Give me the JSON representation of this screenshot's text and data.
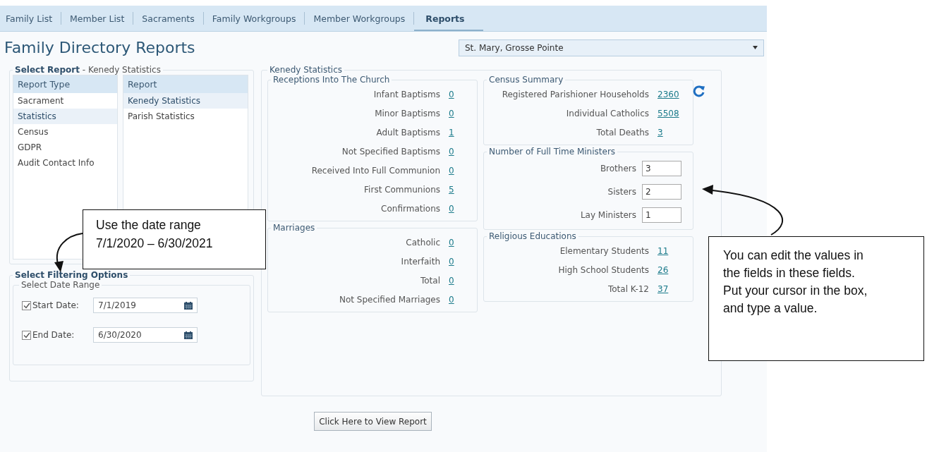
{
  "tabs": [
    {
      "label": "Family List",
      "selected": false
    },
    {
      "label": "Member List",
      "selected": false
    },
    {
      "label": "Sacraments",
      "selected": false
    },
    {
      "label": "Family Workgroups",
      "selected": false
    },
    {
      "label": "Member Workgroups",
      "selected": false
    },
    {
      "label": "Reports",
      "selected": true
    }
  ],
  "page_title": "Family Directory Reports",
  "parish_select": {
    "value": "St. Mary, Grosse Pointe"
  },
  "select_report": {
    "legend": "Select Report",
    "subtitle": "- Kenedy Statistics",
    "columns": [
      {
        "header": "Report Type",
        "items": [
          {
            "label": "Sacrament",
            "selected": false
          },
          {
            "label": "Statistics",
            "selected": true
          },
          {
            "label": "Census",
            "selected": false
          },
          {
            "label": "GDPR",
            "selected": false
          },
          {
            "label": "Audit Contact Info",
            "selected": false
          }
        ]
      },
      {
        "header": "Report",
        "items": [
          {
            "label": "Kenedy Statistics",
            "selected": true
          },
          {
            "label": "Parish Statistics",
            "selected": false
          }
        ]
      }
    ]
  },
  "filtering": {
    "legend": "Select Filtering Options",
    "group": "Select Date Range",
    "dates": [
      {
        "label": "Start Date:",
        "checked": true,
        "value": "7/1/2019"
      },
      {
        "label": "End Date:",
        "checked": true,
        "value": "6/30/2020"
      }
    ]
  },
  "statistics": {
    "legend": "Kenedy Statistics",
    "columns": [
      [
        {
          "title": "Receptions Into The Church",
          "rows": [
            {
              "label": "Infant Baptisms",
              "value": "0",
              "kind": "link"
            },
            {
              "label": "Minor Baptisms",
              "value": "0",
              "kind": "link"
            },
            {
              "label": "Adult Baptisms",
              "value": "1",
              "kind": "link"
            },
            {
              "label": "Not Specified Baptisms",
              "value": "0",
              "kind": "link"
            },
            {
              "label": "Received Into Full Communion",
              "value": "0",
              "kind": "link"
            },
            {
              "label": "First Communions",
              "value": "5",
              "kind": "link"
            },
            {
              "label": "Confirmations",
              "value": "0",
              "kind": "link"
            }
          ]
        },
        {
          "title": "Marriages",
          "rows": [
            {
              "label": "Catholic",
              "value": "0",
              "kind": "link"
            },
            {
              "label": "Interfaith",
              "value": "0",
              "kind": "link"
            },
            {
              "label": "Total",
              "value": "0",
              "kind": "link"
            },
            {
              "label": "Not Specified Marriages",
              "value": "0",
              "kind": "link"
            }
          ]
        }
      ],
      [
        {
          "title": "Census Summary",
          "rows": [
            {
              "label": "Registered Parishioner Households",
              "value": "2360",
              "kind": "link"
            },
            {
              "label": "Individual Catholics",
              "value": "5508",
              "kind": "link"
            },
            {
              "label": "Total Deaths",
              "value": "3",
              "kind": "link"
            }
          ]
        },
        {
          "title": "Number of Full Time Ministers",
          "rows": [
            {
              "label": "Brothers",
              "value": "3",
              "kind": "input"
            },
            {
              "label": "Sisters",
              "value": "2",
              "kind": "input"
            },
            {
              "label": "Lay Ministers",
              "value": "1",
              "kind": "input"
            }
          ]
        },
        {
          "title": "Religious Educations",
          "rows": [
            {
              "label": "Elementary Students",
              "value": "11",
              "kind": "link"
            },
            {
              "label": "High School Students",
              "value": "26",
              "kind": "link"
            },
            {
              "label": "Total K-12",
              "value": "37",
              "kind": "link"
            }
          ]
        }
      ]
    ]
  },
  "view_button": "Click Here to View Report",
  "callouts": [
    {
      "text": "Use the date range\n7/1/2020 – 6/30/2021"
    },
    {
      "text": "You can edit the values in\nthe fields in these fields.\nPut your cursor in the box,\nand type a value."
    }
  ]
}
